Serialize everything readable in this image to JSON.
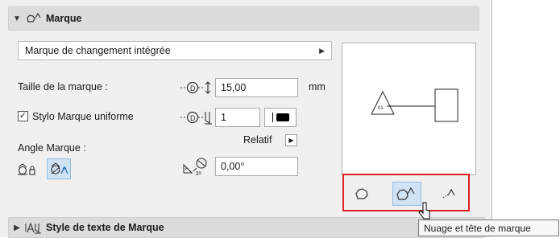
{
  "section_marque": {
    "title": "Marque",
    "state": "expanded"
  },
  "marker_type": {
    "selected": "Marque de changement intégrée"
  },
  "marker_size": {
    "label": "Taille de la marque :",
    "value": "15,00",
    "unit": "mm"
  },
  "uniform_pen": {
    "label": "Stylo Marque uniforme",
    "checked": true,
    "pen_value": "1"
  },
  "angle": {
    "label": "Angle Marque :",
    "mode_label": "Relatif",
    "value": "0,00°"
  },
  "preview": {
    "marker_text": "01"
  },
  "section_text_style": {
    "title": "Style de texte de Marque",
    "state": "collapsed"
  },
  "tooltip": {
    "text": "Nuage et tête de marque"
  },
  "colors": {
    "highlight_border": "#e02020",
    "active_button": "#cfe3f5"
  }
}
